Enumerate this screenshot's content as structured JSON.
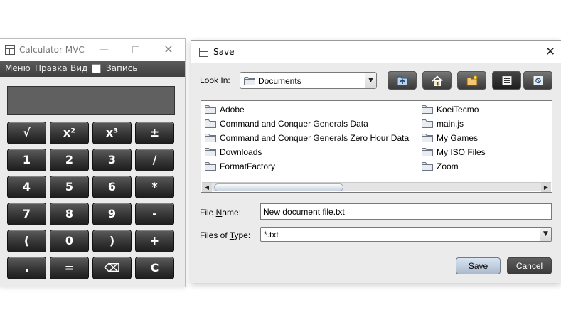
{
  "calculator": {
    "title": "Calculator MVC",
    "menu": [
      "Меню",
      "Правка",
      "Вид",
      "Запись"
    ],
    "keys": [
      [
        "√",
        "x²",
        "x³",
        "±"
      ],
      [
        "1",
        "2",
        "3",
        "/"
      ],
      [
        "4",
        "5",
        "6",
        "*"
      ],
      [
        "7",
        "8",
        "9",
        "-"
      ],
      [
        "(",
        "0",
        ")",
        "+"
      ],
      [
        ".",
        "=",
        "⌫",
        "C"
      ]
    ]
  },
  "save_dialog": {
    "title": "Save",
    "look_in_label": "Look In:",
    "look_in_value": "Documents",
    "toolbar_icons": [
      "up-folder-icon",
      "home-icon",
      "new-folder-icon",
      "list-view-icon",
      "details-view-icon"
    ],
    "files_col1": [
      "Adobe",
      "Command and Conquer Generals Data",
      "Command and Conquer Generals Zero Hour Data",
      "Downloads",
      "FormatFactory"
    ],
    "files_col2": [
      "KoeiTecmo",
      "main.js",
      "My Games",
      "My ISO Files",
      "Zoom"
    ],
    "file_name_label": "File Name:",
    "file_name_value": "New document file.txt",
    "files_of_type_label": "Files of Type:",
    "files_of_type_value": "*.txt",
    "save_button": "Save",
    "cancel_button": "Cancel"
  }
}
